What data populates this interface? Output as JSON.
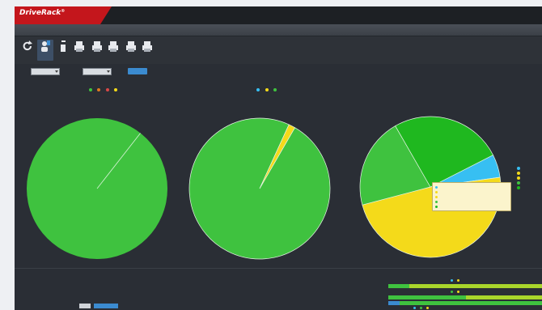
{
  "brand": {
    "name": "DriveRack",
    "superscript": "®",
    "subtitle": ""
  },
  "window": {
    "title": ""
  },
  "toolbar": {
    "items": [
      {
        "label": "",
        "icon": "refresh-icon"
      },
      {
        "label": "",
        "icon": "user-export-icon"
      },
      {
        "label": "",
        "icon": "device-icon"
      },
      {
        "label": "",
        "icon": "printer-icon"
      },
      {
        "label": "",
        "icon": "printer-icon"
      },
      {
        "label": "",
        "icon": "printer-icon"
      },
      {
        "label": "",
        "icon": "printer-icon"
      },
      {
        "label": "",
        "icon": "printer-icon"
      }
    ]
  },
  "filters": {
    "from_label": "",
    "from_value": "",
    "to_label": "",
    "to_value": "",
    "apply_label": "",
    "info": ""
  },
  "colors": {
    "green": "#3fc23f",
    "dark_green": "#1fad1f",
    "yellow": "#f4da1a",
    "blue": "#37bff2",
    "lime": "#a9d62b",
    "accent": "#3b8bd0"
  },
  "chart_data": [
    {
      "type": "pie",
      "title": "",
      "legend": [
        {
          "name": "",
          "color": "#3fc23f"
        },
        {
          "name": "",
          "color": "#e07a20"
        },
        {
          "name": "",
          "color": "#d94848"
        },
        {
          "name": "",
          "color": "#f4da1a"
        }
      ],
      "slices": [
        {
          "name": "",
          "value": 100,
          "color": "#3fc23f"
        }
      ]
    },
    {
      "type": "pie",
      "title": "",
      "legend": [
        {
          "name": "",
          "color": "#37bff2"
        },
        {
          "name": "",
          "color": "#f4da1a"
        },
        {
          "name": "",
          "color": "#3fc23f"
        }
      ],
      "slices": [
        {
          "name": "",
          "value": 98.5,
          "color": "#3fc23f"
        },
        {
          "name": "",
          "value": 1.5,
          "color": "#f4da1a"
        }
      ]
    },
    {
      "type": "pie",
      "title": "",
      "legend": [],
      "slices": [
        {
          "name": "",
          "value": 5.3,
          "color": "#37bff2"
        },
        {
          "name": "",
          "value": 48.1,
          "color": "#f4da1a"
        },
        {
          "name": "",
          "value": 20.8,
          "color": "#3fc23f"
        },
        {
          "name": "",
          "value": 25.8,
          "color": "#1fb81f"
        }
      ]
    }
  ],
  "side_legend": [
    {
      "name": "",
      "color": "#37bff2"
    },
    {
      "name": "",
      "color": "#f4da1a"
    },
    {
      "name": "",
      "color": "#f4da1a"
    },
    {
      "name": "",
      "color": "#3fc23f"
    },
    {
      "name": "",
      "color": "#1fb81f"
    }
  ],
  "tooltip": [
    {
      "key": "",
      "value": "",
      "pct": "",
      "color": "#37bff2"
    },
    {
      "key": "",
      "value": "",
      "pct": "",
      "color": "#f4da1a"
    },
    {
      "key": "",
      "value": "",
      "pct": "",
      "color": "#f4da1a"
    },
    {
      "key": "",
      "value": "",
      "pct": "",
      "color": "#3fc23f"
    },
    {
      "key": "",
      "value": "",
      "pct": "",
      "color": "#1fb81f"
    }
  ],
  "bottom": {
    "left": [
      {
        "label": "",
        "value": ""
      },
      {
        "label": "",
        "value": ""
      },
      {
        "label": "",
        "value": ""
      },
      {
        "label": "",
        "value": ""
      },
      {
        "label": "",
        "value": ""
      }
    ],
    "middle": [
      {
        "label": "",
        "value": ""
      },
      {
        "label": "",
        "value": ""
      },
      {
        "label": "",
        "value": ""
      },
      {
        "label": "",
        "value": ""
      }
    ],
    "right": [
      {
        "label": ""
      },
      {
        "label": ""
      },
      {
        "label": ""
      }
    ],
    "legend_top": [
      "",
      ""
    ],
    "legend_mid": [
      "",
      ""
    ],
    "legend_bot": [
      "",
      "",
      ""
    ],
    "show_label": ""
  }
}
